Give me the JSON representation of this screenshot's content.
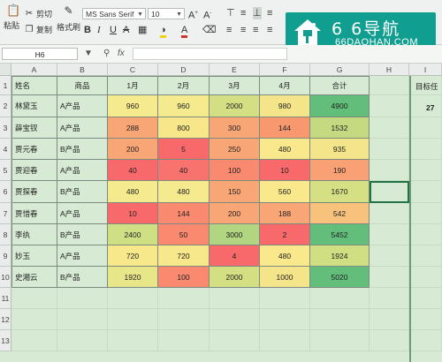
{
  "ribbon": {
    "paste_label": "粘贴",
    "cut_label": "剪切",
    "copy_label": "复制",
    "format_painter_label": "格式刷",
    "font_name": "MS Sans Serif",
    "font_size": "10"
  },
  "formula_bar": {
    "name_box": "H6",
    "fx_label": "fx",
    "formula": ""
  },
  "watermark": {
    "brand_name": "6 6导航",
    "brand_url": "66DAOHAN.COM"
  },
  "column_headers": [
    "A",
    "B",
    "C",
    "D",
    "E",
    "F",
    "G",
    "H",
    "I"
  ],
  "row_numbers": [
    "1",
    "2",
    "3",
    "4",
    "5",
    "6",
    "7",
    "8",
    "9",
    "10",
    "11",
    "12",
    "13"
  ],
  "table": {
    "headers": [
      "姓名",
      "商品",
      "1月",
      "2月",
      "3月",
      "4月",
      "合计"
    ],
    "rows": [
      [
        "林黛玉",
        "A产品",
        "960",
        "960",
        "2000",
        "980",
        "4900"
      ],
      [
        "薛宝钗",
        "A产品",
        "288",
        "800",
        "300",
        "144",
        "1532"
      ],
      [
        "贾元春",
        "B产品",
        "200",
        "5",
        "250",
        "480",
        "935"
      ],
      [
        "贾迎春",
        "A产品",
        "40",
        "40",
        "100",
        "10",
        "190"
      ],
      [
        "贾探春",
        "B产品",
        "480",
        "480",
        "150",
        "560",
        "1670"
      ],
      [
        "贾惜春",
        "A产品",
        "10",
        "144",
        "200",
        "188",
        "542"
      ],
      [
        "李纨",
        "B产品",
        "2400",
        "50",
        "3000",
        "2",
        "5452"
      ],
      [
        "妙玉",
        "A产品",
        "720",
        "720",
        "4",
        "480",
        "1924"
      ],
      [
        "史湘云",
        "B产品",
        "1920",
        "100",
        "2000",
        "1000",
        "5020"
      ]
    ],
    "fill_colors": [
      [
        "#f6ea8e",
        "#f6ea8e",
        "#d3df82",
        "#f4e48a",
        "#63be7b"
      ],
      [
        "#f9a676",
        "#f8e78a",
        "#f9a676",
        "#f7986e",
        "#c5da80"
      ],
      [
        "#f9a676",
        "#f8696b",
        "#f9a676",
        "#f9e88c",
        "#f4e48a"
      ],
      [
        "#f8696b",
        "#f8736e",
        "#f98a6f",
        "#f8696b",
        "#f9a075"
      ],
      [
        "#f6ea8e",
        "#f6ea8e",
        "#f9a676",
        "#f9e88c",
        "#d4e083"
      ],
      [
        "#f8696b",
        "#f98a6f",
        "#f9a676",
        "#f9a676",
        "#f9c27c"
      ],
      [
        "#cfdf84",
        "#f98a6f",
        "#b1d580",
        "#f8696b",
        "#63be7b"
      ],
      [
        "#f8e88c",
        "#f8e88c",
        "#f8696b",
        "#f9e88c",
        "#d0df82"
      ],
      [
        "#e7e689",
        "#f98a6f",
        "#d3df82",
        "#f4e48a",
        "#63be7b"
      ]
    ]
  },
  "side_label": "目标任",
  "side_value": "27"
}
